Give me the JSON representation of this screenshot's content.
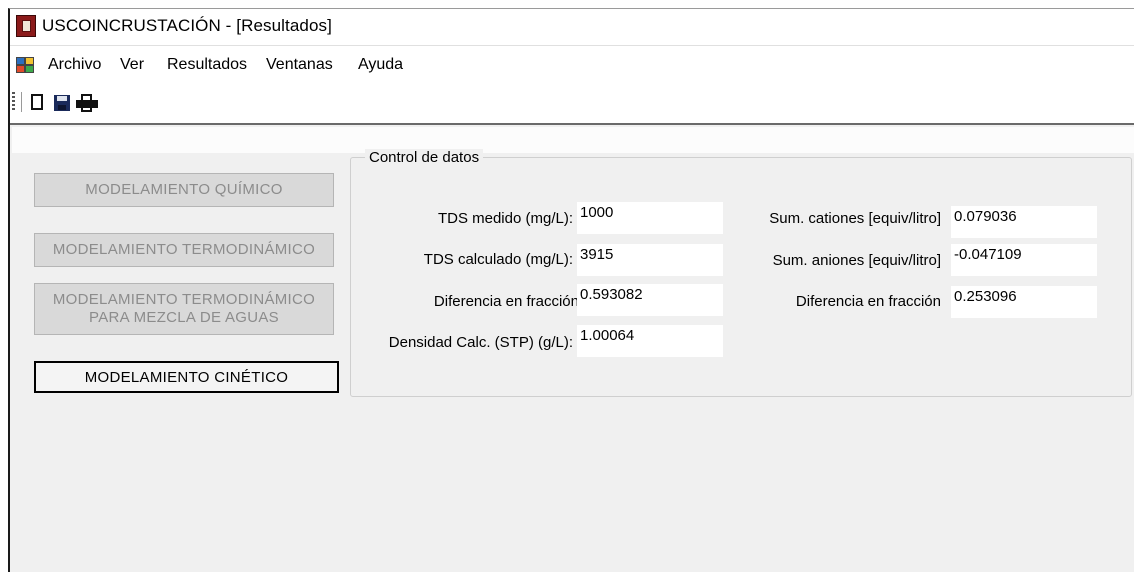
{
  "window": {
    "title": "USCOINCRUSTACIÓN - [Resultados]"
  },
  "menu": {
    "items": [
      {
        "label": "Archivo"
      },
      {
        "label": "Ver"
      },
      {
        "label": "Resultados"
      },
      {
        "label": "Ventanas"
      },
      {
        "label": "Ayuda"
      }
    ]
  },
  "toolbar": {
    "icons": [
      "new-document-icon",
      "save-icon",
      "print-icon"
    ]
  },
  "sidebar": {
    "buttons": [
      {
        "label": "MODELAMIENTO QUÍMICO",
        "enabled": false
      },
      {
        "label": "MODELAMIENTO TERMODINÁMICO",
        "enabled": false
      },
      {
        "label_line1": "MODELAMIENTO TERMODINÁMICO",
        "label_line2": "PARA MEZCLA DE AGUAS",
        "enabled": false
      },
      {
        "label": "MODELAMIENTO CINÉTICO",
        "enabled": true
      }
    ]
  },
  "control": {
    "title": "Control de datos",
    "left": [
      {
        "label": "TDS medido (mg/L):",
        "value": "1000"
      },
      {
        "label": "TDS calculado (mg/L):",
        "value": "3915"
      },
      {
        "label": "Diferencia en fracción",
        "value": "0.593082"
      },
      {
        "label": "Densidad Calc. (STP) (g/L):",
        "value": "1.00064"
      }
    ],
    "right": [
      {
        "label": "Sum. cationes [equiv/litro]",
        "value": "0.079036"
      },
      {
        "label": "Sum. aniones [equiv/litro]",
        "value": "-0.047109"
      },
      {
        "label": "Diferencia en fracción",
        "value": "0.253096"
      }
    ]
  },
  "colors": {
    "app_icon": "#8b1a1a",
    "client_background": "#f0f0f0",
    "disabled_button": "#d9d9d9",
    "disabled_text": "#8c8c8c"
  }
}
